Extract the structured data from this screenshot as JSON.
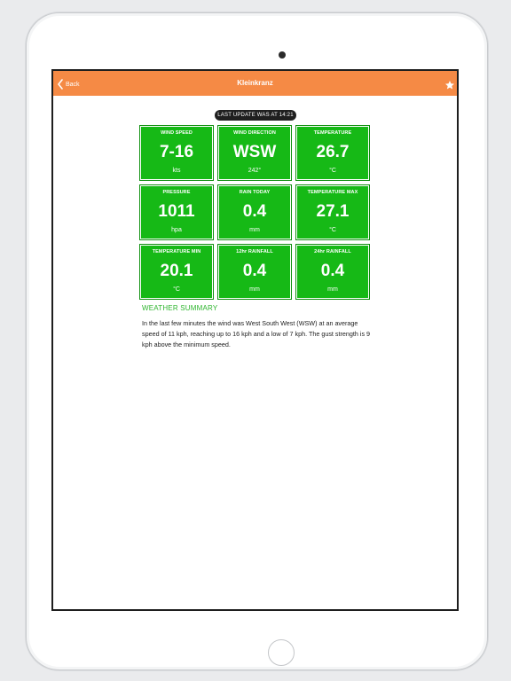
{
  "navbar": {
    "back_label": "Back",
    "title": "Kleinkranz",
    "star_icon": "star-icon"
  },
  "pager": {
    "count": 3,
    "active": 0
  },
  "update_label": "LAST UPDATE WAS AT 14:21",
  "tiles": [
    {
      "label": "WIND SPEED",
      "value": "7-16",
      "unit": "kts"
    },
    {
      "label": "WIND DIRECTION",
      "value": "WSW",
      "unit": "242°"
    },
    {
      "label": "TEMPERATURE",
      "value": "26.7",
      "unit": "°C"
    },
    {
      "label": "PRESSURE",
      "value": "1011",
      "unit": "hpa"
    },
    {
      "label": "RAIN TODAY",
      "value": "0.4",
      "unit": "mm"
    },
    {
      "label": "TEMPERATURE MAX",
      "value": "27.1",
      "unit": "°C"
    },
    {
      "label": "TEMPERATURE MIN",
      "value": "20.1",
      "unit": "°C"
    },
    {
      "label": "12hr RAINFALL",
      "value": "0.4",
      "unit": "mm"
    },
    {
      "label": "24hr RAINFALL",
      "value": "0.4",
      "unit": "mm"
    }
  ],
  "summary": {
    "title": "WEATHER SUMMARY",
    "text": "In the last few minutes the wind was West South West (WSW) at an average speed of 11 kph, reaching up to 16 kph and a low of 7 kph. The gust strength is 9 kph above the minimum speed."
  },
  "colors": {
    "navbar": "#f58a45",
    "tile": "#16b916",
    "accent_green": "#2fb62f"
  }
}
